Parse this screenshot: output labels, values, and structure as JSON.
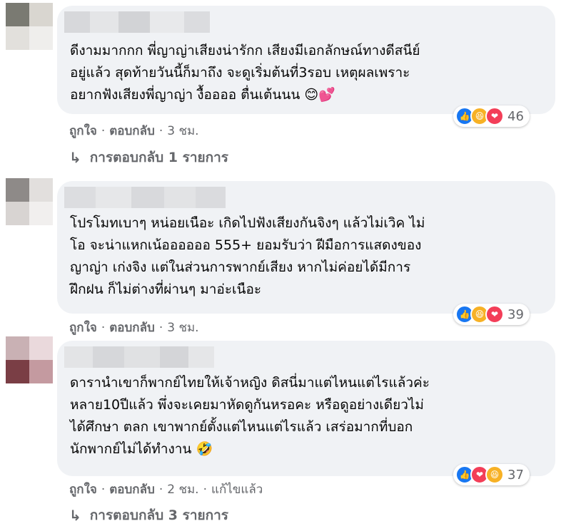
{
  "comments": [
    {
      "text": "ดีงามมากกก พี่ญาญ่าเสียงน่ารักก เสียงมีเอกลักษณ์ทางดีสนีย์\nอยู่แล้ว สุดท้ายวันนี้ก็มาถึง จะดูเริ่มต้นที่3รอบ เหตุผลเพราะ\nอยากฟังเสียงพี่ญาญ่า งื้ออออ ตื่นเต้นนน 😊💕",
      "reaction_count": "46",
      "reactions": [
        "like-icon",
        "haha-icon",
        "love-icon"
      ],
      "like_label": "ถูกใจ",
      "reply_label": "ตอบกลับ",
      "time": "3 ชม.",
      "separator": "·",
      "replies_link": "การตอบกลับ 1 รายการ"
    },
    {
      "text": "โปรโมทเบาๆ หน่อยเนือะ เกิดไปฟังเสียงกันจิงๆ แล้วไม่เวิค ไม่\nโอ จะน่าแหกเน้ออออออ 555+ ยอมรับว่า ฝีมือการแสดงของ\nญาญ่า เก่งจิง แต่ในส่วนการพากย์เสียง หากไม่ค่อยได้มีการ\nฝึกฝน ก็ไม่ต่างที่ผ่านๆ มาอ่ะเนือะ",
      "reaction_count": "39",
      "reactions": [
        "like-icon",
        "haha-icon",
        "love-icon"
      ],
      "like_label": "ถูกใจ",
      "reply_label": "ตอบกลับ",
      "time": "3 ชม.",
      "separator": "·"
    },
    {
      "text": "ดารานำเขาก็พากย์ไทยให้เจ้าหญิง ดิสนี่มาแต่ไหนแต่ไรแล้วค่ะ\nหลาย10ปีแล้ว พึ่งจะเคยมาหัดดูกันหรอคะ หรือดูอย่างเดียวไม่\nได้ศึกษา ตลก เขาพากย์ตั้งแต่ไหนแต่ไรแล้ว เสร่อมากที่บอก\nนักพากย์ไม่ได้ทำงาน 🤣",
      "reaction_count": "37",
      "reactions": [
        "like-icon",
        "love-icon",
        "haha-icon"
      ],
      "like_label": "ถูกใจ",
      "reply_label": "ตอบกลับ",
      "time": "2 ชม.",
      "separator": "·",
      "edited": "แก้ไขแล้ว",
      "replies_link": "การตอบกลับ 3 รายการ"
    }
  ],
  "colors": {
    "bubble": "#f0f2f5",
    "meta_text": "#65676b",
    "like": "#1877f2",
    "haha": "#f7b125",
    "love": "#f33e58"
  }
}
